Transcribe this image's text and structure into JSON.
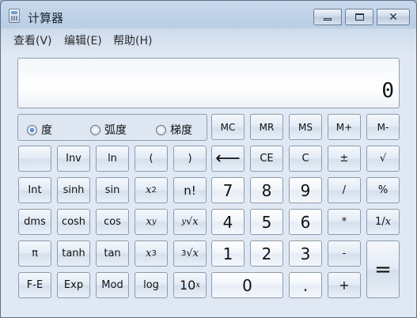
{
  "window": {
    "title": "计算器"
  },
  "menu": [
    "查看(V)",
    "编辑(E)",
    "帮助(H)"
  ],
  "display": {
    "value": "0"
  },
  "angle_modes": [
    {
      "label": "度",
      "selected": true
    },
    {
      "label": "弧度",
      "selected": false
    },
    {
      "label": "梯度",
      "selected": false
    }
  ],
  "memory_keys": [
    "MC",
    "MR",
    "MS",
    "M+",
    "M-"
  ],
  "keys": {
    "inv": "Inv",
    "ln": "ln",
    "lparen": "(",
    "rparen": ")",
    "backspace": "⟵",
    "ce": "CE",
    "c": "C",
    "plusminus": "±",
    "sqrt": "√",
    "int": "Int",
    "sinh": "sinh",
    "sin": "sin",
    "x2_base": "x",
    "x2_exp": "2",
    "factorial": "n!",
    "d7": "7",
    "d8": "8",
    "d9": "9",
    "divide": "/",
    "percent": "%",
    "dms": "dms",
    "cosh": "cosh",
    "cos": "cos",
    "xy_base": "x",
    "xy_exp": "y",
    "yroot_index": "y",
    "yroot_sym": "√",
    "yroot_x": "x",
    "d4": "4",
    "d5": "5",
    "d6": "6",
    "multiply": "*",
    "recip_num": "1/",
    "recip_x": "x",
    "pi": "π",
    "tanh": "tanh",
    "tan": "tan",
    "x3_base": "x",
    "x3_exp": "3",
    "cbrt_index": "3",
    "cbrt_sym": "√",
    "cbrt_x": "x",
    "d1": "1",
    "d2": "2",
    "d3": "3",
    "minus": "-",
    "equals": "=",
    "fe": "F-E",
    "exp": "Exp",
    "mod": "Mod",
    "log": "log",
    "tenx_base": "10",
    "tenx_exp": "x",
    "d0": "0",
    "decimal": ".",
    "plus": "+"
  },
  "colors": {
    "accent": "#1f5fb4",
    "window_frame": "#5a6f88"
  }
}
